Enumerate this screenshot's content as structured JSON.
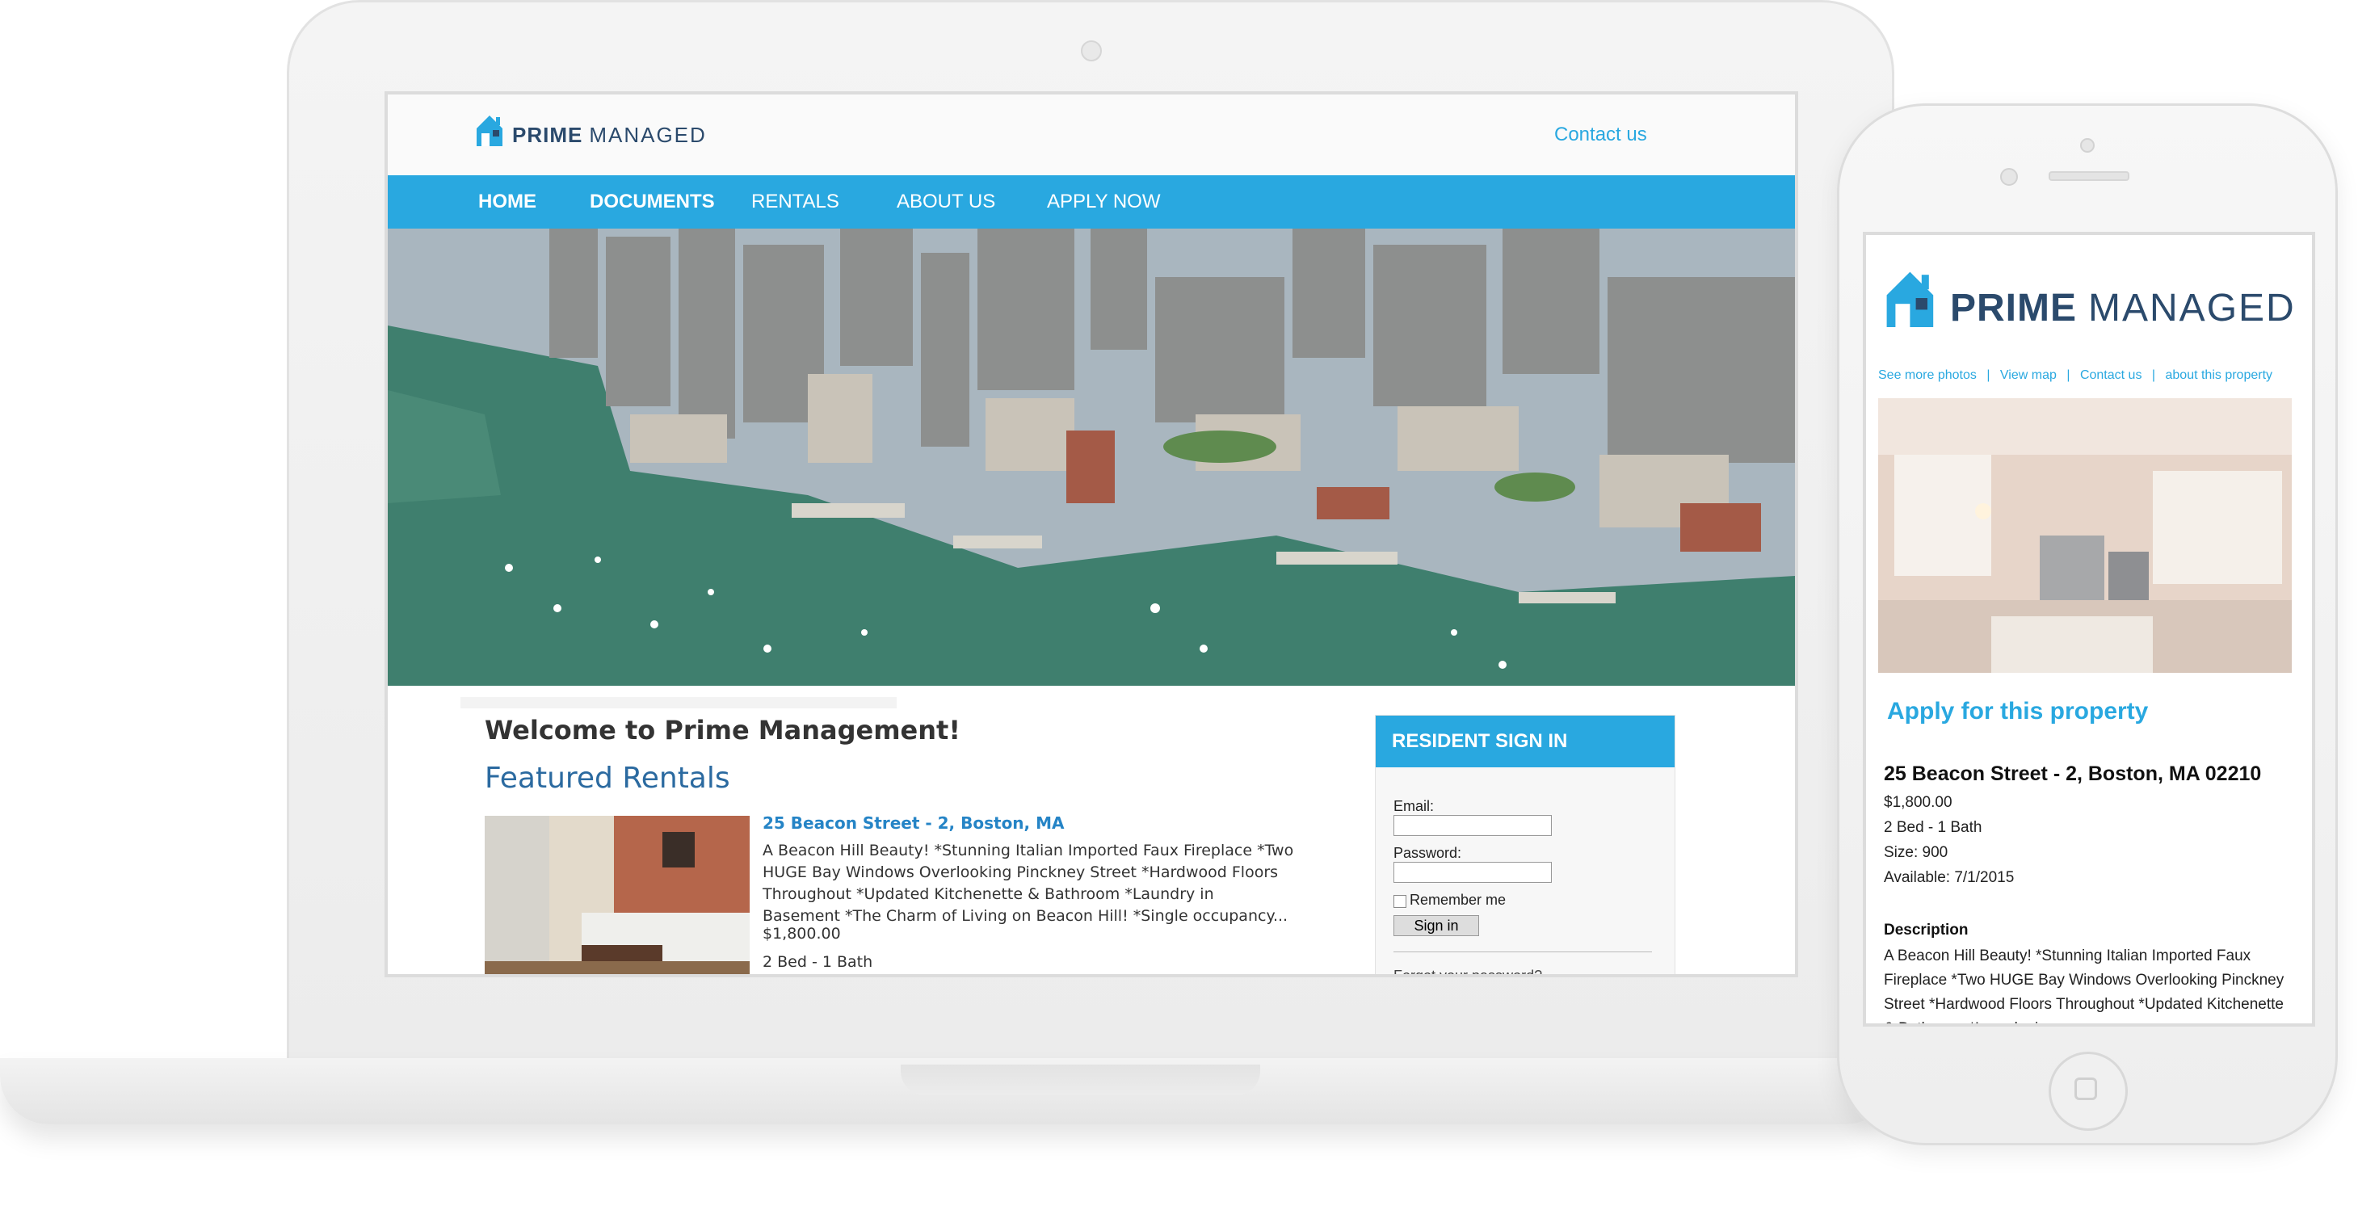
{
  "brand": {
    "prime": "PRIME",
    "managed": "MANAGED",
    "accent_color": "#29a8e0",
    "navy_color": "#2b4a6c"
  },
  "header": {
    "contact_link": "Contact us"
  },
  "nav": {
    "items": [
      {
        "label": "HOME",
        "active": true
      },
      {
        "label": "DOCUMENTS",
        "active": false
      },
      {
        "label": "RENTALS",
        "active": false
      },
      {
        "label": "ABOUT US",
        "active": false
      },
      {
        "label": "APPLY NOW",
        "active": false
      }
    ]
  },
  "main": {
    "welcome": "Welcome to Prime Management!",
    "featured_heading": "Featured Rentals",
    "listing": {
      "title": "25 Beacon Street - 2, Boston, MA",
      "description": "A Beacon Hill Beauty! *Stunning Italian Imported Faux Fireplace *Two HUGE Bay Windows Overlooking Pinckney Street *Hardwood Floors Throughout *Updated Kitchenette & Bathroom *Laundry in Basement *The Charm of Living on Beacon Hill! *Single occupancy...",
      "price": "$1,800.00",
      "beds_baths": "2 Bed - 1 Bath"
    }
  },
  "signin": {
    "heading": "RESIDENT SIGN IN",
    "email_label": "Email:",
    "password_label": "Password:",
    "remember_label": "Remember me",
    "button_label": "Sign in",
    "forgot_link": "Forgot your password?"
  },
  "phone": {
    "links": [
      "See more photos",
      "View map",
      "Contact us",
      "about this property"
    ],
    "separator": "|",
    "apply_heading": "Apply for this property",
    "address": "25 Beacon Street - 2, Boston, MA 02210",
    "price": "$1,800.00",
    "beds_baths": "2 Bed - 1 Bath",
    "size": "Size: 900",
    "available": "Available: 7/1/2015",
    "description_heading": "Description",
    "description": "A Beacon Hill Beauty! *Stunning Italian Imported Faux Fireplace *Two HUGE Bay Windows Overlooking Pinckney Street *Hardwood Floors Throughout *Updated Kitchenette & Bathroom *Laundry in"
  }
}
